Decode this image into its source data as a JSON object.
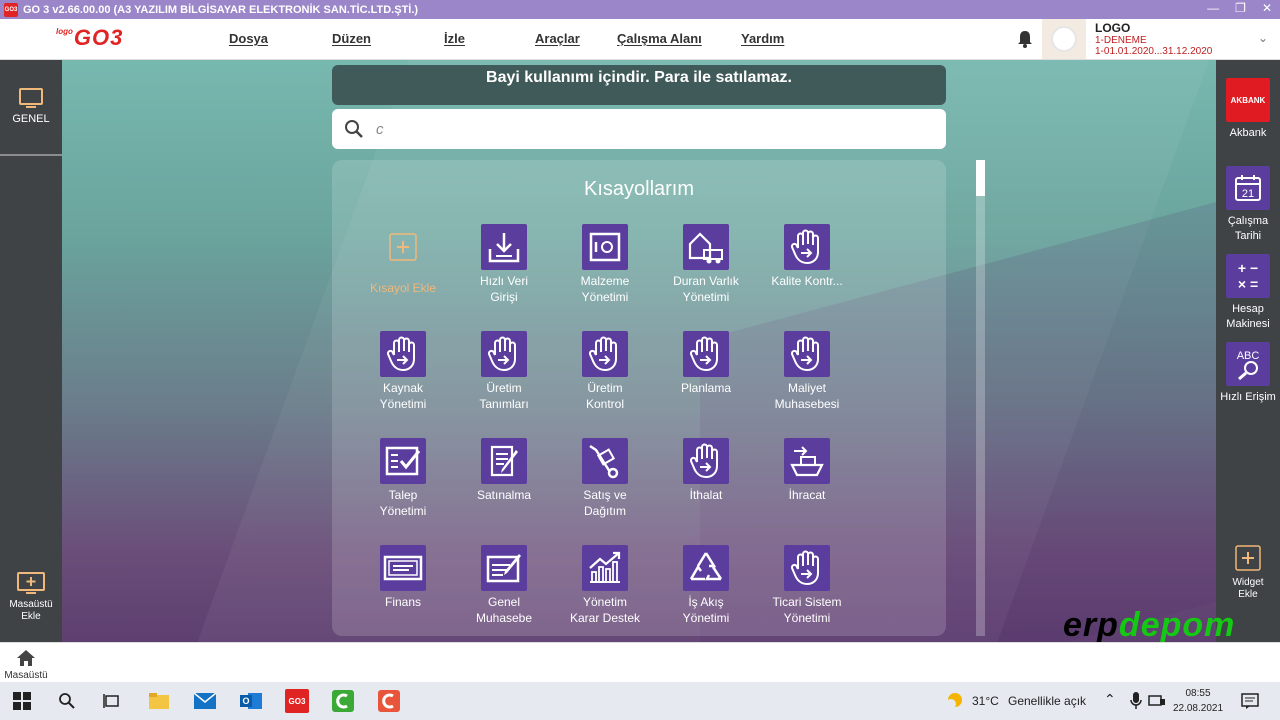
{
  "window": {
    "title": "GO 3 v2.66.00.00 (A3 YAZILIM BİLGİSAYAR ELEKTRONİK SAN.TİC.LTD.ŞTİ.)",
    "app_icon_text": "GO3",
    "controls": [
      "—",
      "❐",
      "✕"
    ]
  },
  "brand": {
    "small": "logo",
    "main": "GO3"
  },
  "menu": [
    {
      "label": "Dosya"
    },
    {
      "label": "Düzen"
    },
    {
      "label": "İzle"
    },
    {
      "label": "Araçlar"
    },
    {
      "label": "Çalışma Alanı"
    },
    {
      "label": "Yardım"
    }
  ],
  "company": {
    "name": "LOGO",
    "firm": "1-DENEME",
    "period": "1-01.01.2020...31.12.2020"
  },
  "left_sidebar": {
    "genel": "GENEL",
    "desktop_add": "Masaüstü\nEkle"
  },
  "right_sidebar": [
    {
      "label": "Akbank",
      "icon_text": "AKBANK"
    },
    {
      "label": "Çalışma\nTarihi",
      "icon_text": "21"
    },
    {
      "label": "Hesap\nMakinesi",
      "icon_text": "+ −\n× ="
    },
    {
      "label": "Hızlı Erişim",
      "icon_text": "ABC"
    }
  ],
  "widget_add": "Widget\nEkle",
  "banner": "Bayi kullanımı içindir. Para ile satılamaz.",
  "search": {
    "value": "c"
  },
  "panel_title": "Kısayollarım",
  "shortcuts": [
    {
      "label": "Kısayol Ekle",
      "icon": "plus-icon"
    },
    {
      "label": "Hızlı Veri\nGirişi",
      "icon": "download-tray-icon"
    },
    {
      "label": "Malzeme\nYönetimi",
      "icon": "safe-box-icon"
    },
    {
      "label": "Duran Varlık\nYönetimi",
      "icon": "house-truck-icon"
    },
    {
      "label": "Kalite Kontr...",
      "icon": "hand-arrow-icon"
    },
    {
      "label": "Kaynak\nYönetimi",
      "icon": "hand-arrow-icon"
    },
    {
      "label": "Üretim\nTanımları",
      "icon": "hand-arrow-icon"
    },
    {
      "label": "Üretim\nKontrol",
      "icon": "hand-arrow-icon"
    },
    {
      "label": "Planlama",
      "icon": "hand-arrow-icon"
    },
    {
      "label": "Maliyet\nMuhasebesi",
      "icon": "hand-arrow-icon"
    },
    {
      "label": "Talep\nYönetimi",
      "icon": "checklist-icon"
    },
    {
      "label": "Satınalma",
      "icon": "document-pen-icon"
    },
    {
      "label": "Satış ve\nDağıtım",
      "icon": "hand-truck-icon"
    },
    {
      "label": "İthalat",
      "icon": "hand-arrow-icon"
    },
    {
      "label": "İhracat",
      "icon": "ship-icon"
    },
    {
      "label": "Finans",
      "icon": "banknote-icon"
    },
    {
      "label": "Genel\nMuhasebe",
      "icon": "ledger-pen-icon"
    },
    {
      "label": "Yönetim\nKarar Destek",
      "icon": "chart-growth-icon"
    },
    {
      "label": "İş Akış\nYönetimi",
      "icon": "recycle-icon"
    },
    {
      "label": "Ticari Sistem\nYönetimi",
      "icon": "hand-arrow-icon"
    }
  ],
  "watermark": {
    "part1": "erp",
    "part2": "depom"
  },
  "bottom": {
    "home_label": "Masaüstü"
  },
  "taskbar": {
    "weather": "31°C",
    "weather_desc": "Genellikle açık",
    "time": "08:55",
    "date": "22.08.2021",
    "go3_icon_text": "GO3"
  }
}
